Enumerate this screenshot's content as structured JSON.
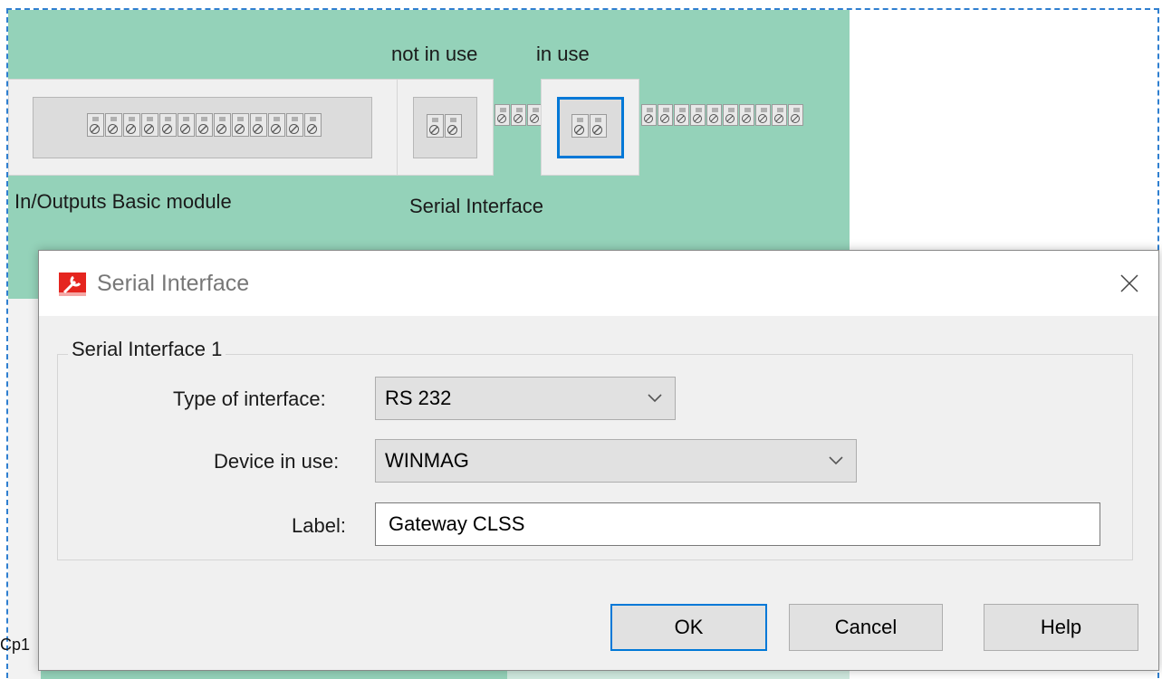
{
  "background": {
    "header_left": "not in use",
    "header_right": "in use",
    "module_label": "In/Outputs Basic module",
    "serial_label": "Serial Interface",
    "cut_text": "Cp1",
    "panel_color": "#94d2b9",
    "selection_color": "#0078d7"
  },
  "dialog": {
    "title": "Serial Interface",
    "group_title": "Serial Interface 1",
    "fields": {
      "type_label": "Type of interface:",
      "type_value": "RS 232",
      "device_label": "Device in use:",
      "device_value": "WINMAG",
      "label_label": "Label:",
      "label_value": "Gateway CLSS"
    },
    "buttons": {
      "ok": "OK",
      "cancel": "Cancel",
      "help": "Help"
    },
    "icons": {
      "app": "wrench-app-icon",
      "close": "close-icon",
      "dropdown": "chevron-down-icon"
    }
  }
}
